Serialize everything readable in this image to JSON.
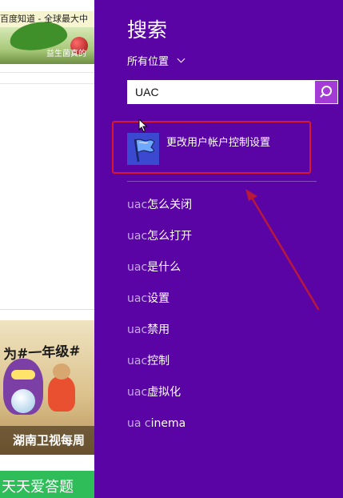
{
  "colors": {
    "panel": "#5a04a6",
    "accent": "#a53bd6",
    "annotation": "#d9182e"
  },
  "background": {
    "tab_title": "百度知道 - 全球最大中",
    "banner_text": "益生菌真的",
    "promo_top_text": "为#一年级#",
    "promo_bottom_text": "湖南卫视每周",
    "bottom_banner_text": "天天爱答题"
  },
  "search_charm": {
    "title": "搜索",
    "scope_label": "所有位置",
    "query": "UAC",
    "top_result": {
      "label": "更改用户帐户控制设置",
      "icon": "uac-flag-icon"
    },
    "suggestions": [
      {
        "q": "uac",
        "rest": "怎么关闭"
      },
      {
        "q": "uac",
        "rest": "怎么打开"
      },
      {
        "q": "uac",
        "rest": "是什么"
      },
      {
        "q": "uac",
        "rest": "设置"
      },
      {
        "q": "uac",
        "rest": "禁用"
      },
      {
        "q": "uac",
        "rest": "控制"
      },
      {
        "q": "uac",
        "rest": "虚拟化"
      },
      {
        "q": "ua c",
        "rest": "inema"
      }
    ]
  }
}
